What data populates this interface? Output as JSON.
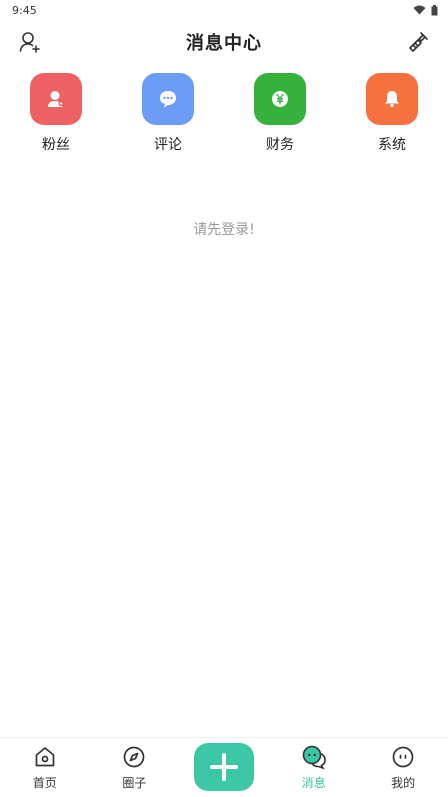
{
  "status_bar": {
    "time": "9:45"
  },
  "header": {
    "title": "消息中心"
  },
  "categories": [
    {
      "label": "粉丝",
      "icon": "fans-icon",
      "color": "#ee6164"
    },
    {
      "label": "评论",
      "icon": "comment-icon",
      "color": "#6c9cf6"
    },
    {
      "label": "财务",
      "icon": "finance-icon",
      "color": "#35b13c"
    },
    {
      "label": "系统",
      "icon": "bell-icon",
      "color": "#f57140"
    }
  ],
  "empty_state": {
    "message": "请先登录!"
  },
  "tabbar": {
    "active_color": "#3cc6a4",
    "items": [
      {
        "label": "首页",
        "icon": "home-icon"
      },
      {
        "label": "圈子",
        "icon": "compass-icon"
      },
      {
        "label": "",
        "icon": "plus-icon"
      },
      {
        "label": "消息",
        "icon": "message-icon",
        "active": true
      },
      {
        "label": "我的",
        "icon": "profile-icon"
      }
    ]
  }
}
